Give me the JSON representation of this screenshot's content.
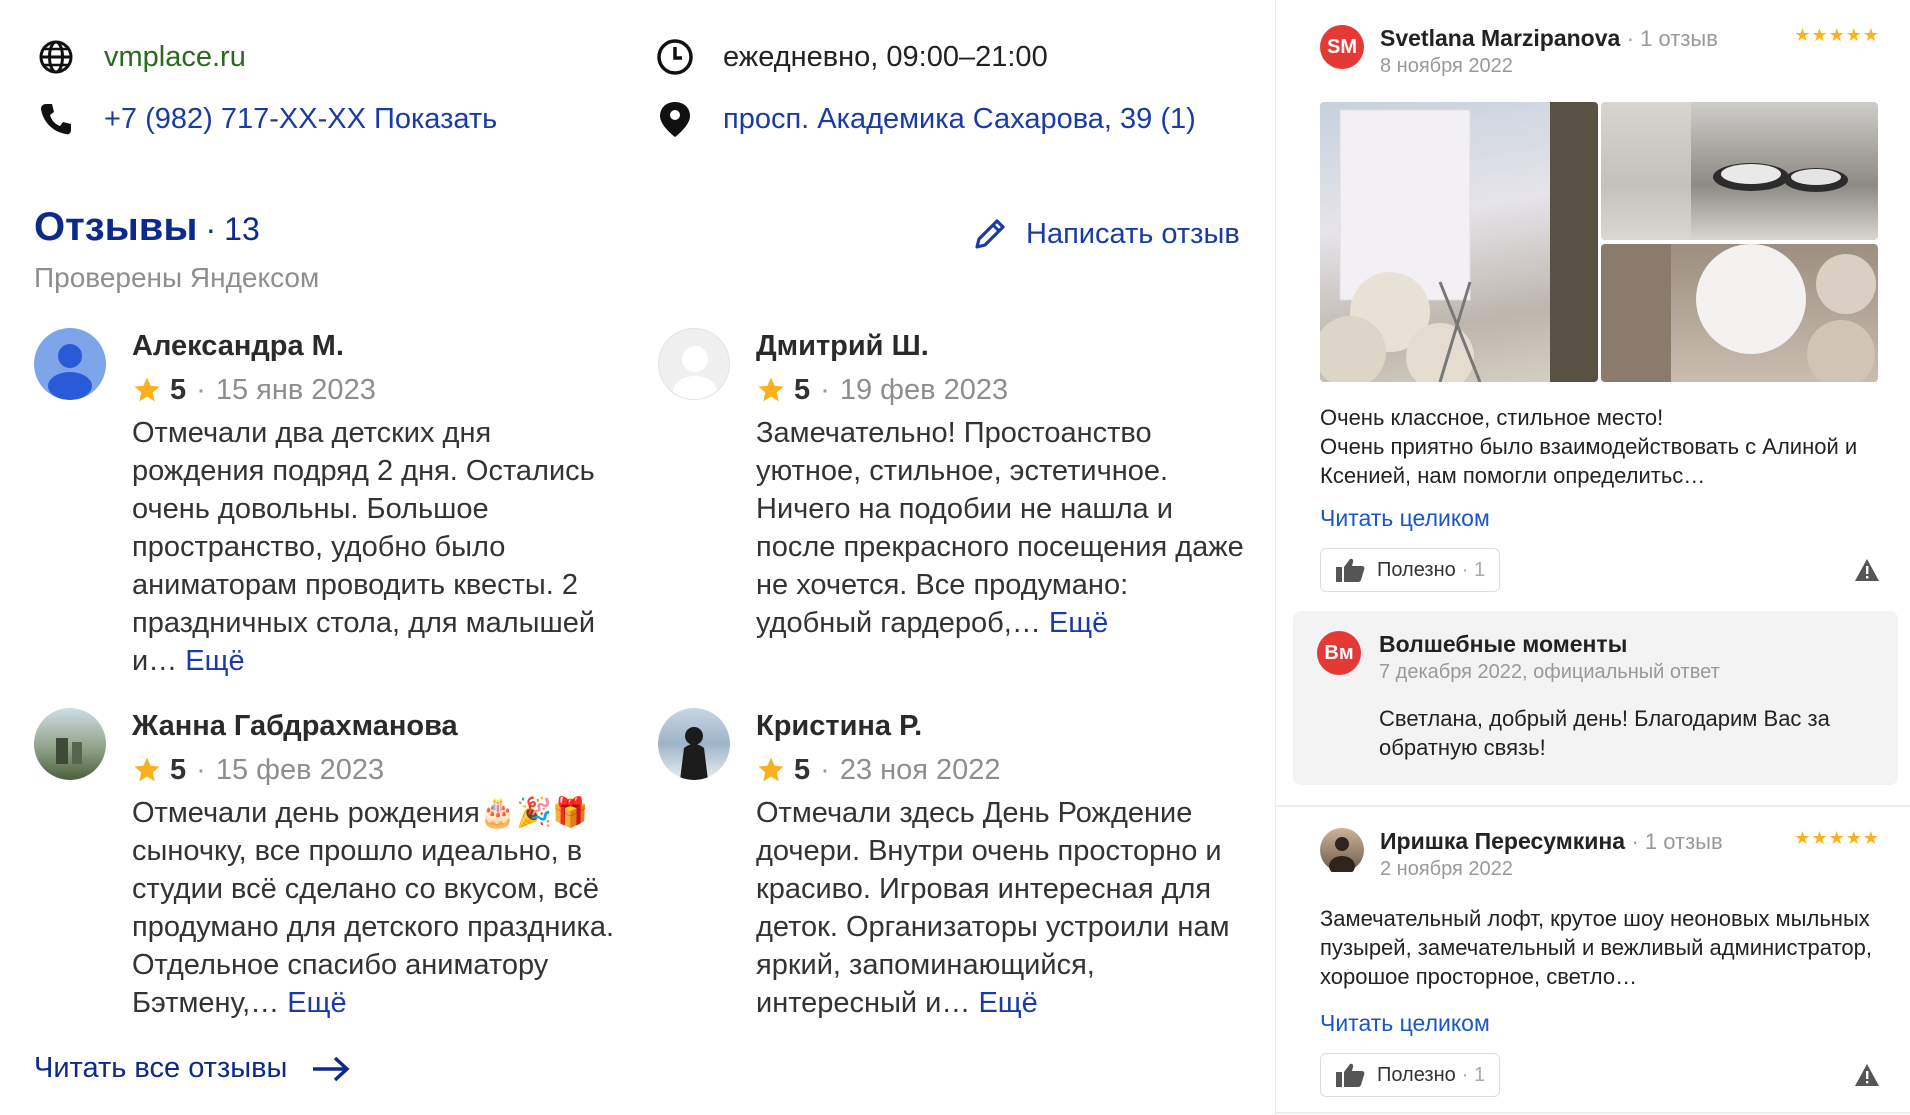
{
  "contacts": {
    "website": "vmplace.ru",
    "phone": "+7 (982) 717-XX-XX Показать",
    "hours": "ежедневно, 09:00–21:00",
    "address": "просп. Академика Сахарова, 39 (1)"
  },
  "reviews": {
    "title": "Отзывы",
    "dot": "·",
    "count": "13",
    "verified": "Проверены Яндексом",
    "write_label": "Написать отзыв",
    "read_all_label": "Читать все отзывы",
    "items": [
      {
        "name": "Александра М.",
        "rating": "5",
        "date": "15 янв 2023",
        "text": "Отмечали два детских дня рождения подряд 2 дня. Остались очень довольны. Большое пространство, удобно было аниматорам проводить квесты. 2 праздничных стола, для малышей и…",
        "more": "Ещё"
      },
      {
        "name": "Дмитрий Ш.",
        "rating": "5",
        "date": "19 фев 2023",
        "text": "Замечательно! Простоанство уютное, стильное, эстетичное. Ничего на подобии не нашла и после прекрасного посещения даже не хочется. Все продумано: удобный гардероб,…",
        "more": "Ещё"
      },
      {
        "name": "Жанна Габдрахманова",
        "rating": "5",
        "date": "15 фев 2023",
        "text": "Отмечали день рождения🎂🎉🎁 сыночку, все прошло идеально, в студии всё сделано со вкусом, всё продумано для детского праздника. Отдельное спасибо аниматору Бэтмену,…",
        "more": "Ещё"
      },
      {
        "name": "Кристина Р.",
        "rating": "5",
        "date": "23 ноя 2022",
        "text": "Отмечали здесь День Рождение дочери. Внутри очень просторно и красиво. Игровая интересная для деток. Организаторы устроили нам яркий, запоминающийся, интересный и…",
        "more": "Ещё"
      }
    ],
    "sep": "·"
  },
  "side": {
    "card1": {
      "initials": "SM",
      "name": "Svetlana Marzipanova",
      "count": "1 отзыв",
      "date": "8 ноября 2022",
      "stars": "★★★★★",
      "text1": "Очень классное, стильное место!",
      "text2": "Очень приятно было взаимодействовать с Алиной и Ксенией, нам помогли определитьс…",
      "read_full": "Читать целиком",
      "useful_label": "Полезно",
      "useful_count": "1"
    },
    "reply": {
      "initials": "Вм",
      "name": "Волшебные моменты",
      "date": "7 декабря 2022, официальный ответ",
      "text": "Светлана, добрый день! Благодарим Вас за обратную связь!"
    },
    "card2": {
      "name": "Иришка Пересумкина",
      "count": "1 отзыв",
      "date": "2 ноября 2022",
      "stars": "★★★★★",
      "text": "Замечательный лофт, крутое шоу неоновых мыльных пузырей, замечательный и вежливый администратор, хорошое просторное, светло…",
      "read_full": "Читать целиком",
      "useful_label": "Полезно",
      "useful_count": "1"
    }
  },
  "colors": {
    "brand_blue": "#0d2a8a",
    "link_blue": "#1a3ba3",
    "site_green": "#2a6a1e",
    "star_yellow": "#fbb01e",
    "avatar_red": "#e53935"
  }
}
